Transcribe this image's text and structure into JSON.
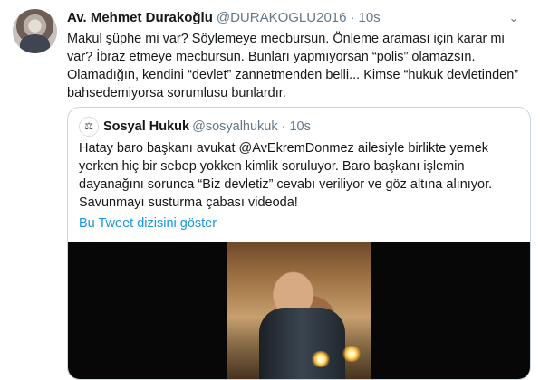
{
  "tweet": {
    "author_name": "Av. Mehmet Durakoğlu",
    "handle": "@DURAKOGLU2016",
    "separator": "·",
    "time": "10s",
    "caret": "⌄",
    "text": "Makul şüphe mi var? Söylemeye mecbursun. Önleme araması için karar mi var? İbraz etmeye mecbursun. Bunları yapmıyorsan “polis” olamazsın. Olamadığın, kendini “devlet” zannetmenden belli... Kimse “hukuk devletinden” bahsedemiyorsa sorumlusu bunlardır."
  },
  "quoted_tweet": {
    "author_name": "Sosyal Hukuk",
    "handle": "@sosyalhukuk",
    "separator": "·",
    "time": "10s",
    "text": "Hatay baro başkanı avukat @AvEkremDonmez ailesiyle birlikte yemek yerken hiç bir sebep yokken kimlik soruluyor. Baro başkanı işlemin dayanağını sorunca “Biz devletiz” cevabı veriliyor ve göz altına alınıyor. Savunmayı susturma çabası videoda!",
    "thread_link": "Bu Tweet dizisini göster"
  },
  "icons": {
    "more": "chevron-down-icon",
    "quoted_avatar": "scale-logo-icon",
    "video": "video-thumbnail"
  },
  "colors": {
    "link": "#1b95e0",
    "secondary_text": "#657786",
    "border": "#ccd6dd"
  }
}
